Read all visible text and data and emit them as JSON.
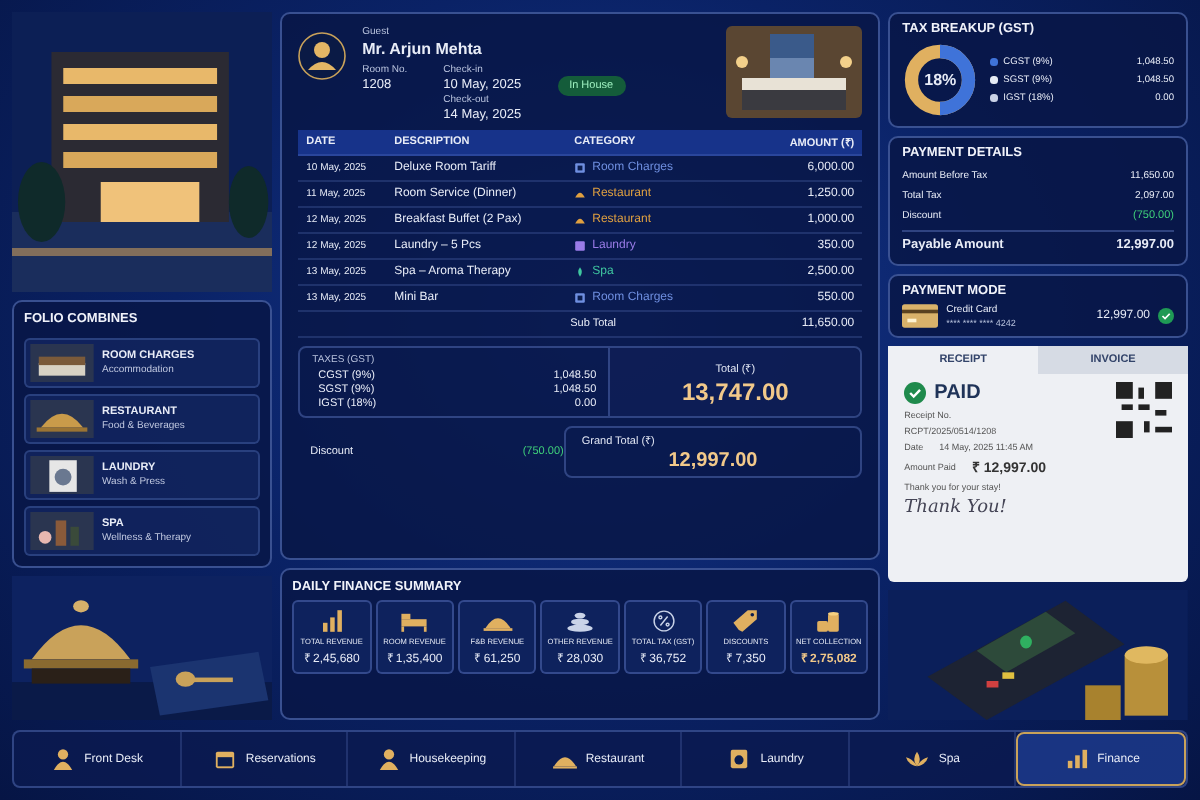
{
  "folio": {
    "title": "FOLIO COMBINES",
    "items": [
      {
        "name": "ROOM CHARGES",
        "sub": "Accommodation",
        "kind": "room"
      },
      {
        "name": "RESTAURANT",
        "sub": "Food & Beverages",
        "kind": "cloche"
      },
      {
        "name": "LAUNDRY",
        "sub": "Wash & Press",
        "kind": "washer"
      },
      {
        "name": "SPA",
        "sub": "Wellness & Therapy",
        "kind": "spa"
      }
    ]
  },
  "guest": {
    "label": "Guest",
    "name": "Mr. Arjun Mehta",
    "room_label": "Room No.",
    "room": "1208",
    "checkin_label": "Check-in",
    "checkin": "10 May, 2025",
    "checkout_label": "Check-out",
    "checkout": "14 May, 2025",
    "status": "In House"
  },
  "table": {
    "columns": [
      "DATE",
      "DESCRIPTION",
      "CATEGORY",
      "AMOUNT (₹)"
    ],
    "rows": [
      {
        "date": "10 May, 2025",
        "description": "Deluxe Room Tariff",
        "category": "Room Charges",
        "kind": "room",
        "color": "#6f8fe0",
        "amount": "6,000.00"
      },
      {
        "date": "11 May, 2025",
        "description": "Room Service (Dinner)",
        "category": "Restaurant",
        "kind": "food",
        "color": "#e0a040",
        "amount": "1,250.00"
      },
      {
        "date": "12 May, 2025",
        "description": "Breakfast Buffet (2 Pax)",
        "category": "Restaurant",
        "kind": "food",
        "color": "#e0a040",
        "amount": "1,000.00"
      },
      {
        "date": "12 May, 2025",
        "description": "Laundry – 5 Pcs",
        "category": "Laundry",
        "kind": "laundry",
        "color": "#9a7ce8",
        "amount": "350.00"
      },
      {
        "date": "13 May, 2025",
        "description": "Spa – Aroma Therapy",
        "category": "Spa",
        "kind": "spa",
        "color": "#3fc7a0",
        "amount": "2,500.00"
      },
      {
        "date": "13 May, 2025",
        "description": "Mini Bar",
        "category": "Room Charges",
        "kind": "room",
        "color": "#6f8fe0",
        "amount": "550.00"
      }
    ],
    "subtotal_label": "Sub Total",
    "subtotal": "11,650.00"
  },
  "taxes": {
    "title": "TAXES (GST)",
    "rows": [
      {
        "label": "CGST (9%)",
        "value": "1,048.50"
      },
      {
        "label": "SGST (9%)",
        "value": "1,048.50"
      },
      {
        "label": "IGST (18%)",
        "value": "0.00"
      }
    ],
    "total_label": "Total (₹)",
    "total": "13,747.00",
    "discount_label": "Discount",
    "discount": "(750.00)",
    "grand_label": "Grand Total (₹)",
    "grand": "12,997.00"
  },
  "tax_breakup": {
    "title": "TAX BREAKUP (GST)",
    "center": "18%",
    "items": [
      {
        "label": "CGST (9%)",
        "value": "1,048.50",
        "color": "#3f73d9"
      },
      {
        "label": "SGST (9%)",
        "value": "1,048.50",
        "color": "#e6ebf5"
      },
      {
        "label": "IGST (18%)",
        "value": "0.00",
        "color": "#c9d2e6"
      }
    ]
  },
  "payment_details": {
    "title": "PAYMENT DETAILS",
    "rows": [
      {
        "label": "Amount Before Tax",
        "value": "11,650.00",
        "kind": "plain"
      },
      {
        "label": "Total Tax",
        "value": "2,097.00",
        "kind": "plain"
      },
      {
        "label": "Discount",
        "value": "(750.00)",
        "kind": "discount"
      }
    ],
    "payable_label": "Payable Amount",
    "payable": "12,997.00"
  },
  "payment_mode": {
    "title": "PAYMENT MODE",
    "method": "Credit Card",
    "card": "**** **** **** 4242",
    "amount": "12,997.00",
    "verified": true
  },
  "receipt": {
    "tabs": [
      {
        "label": "RECEIPT",
        "selected": true
      },
      {
        "label": "INVOICE",
        "selected": false
      }
    ],
    "status": "PAID",
    "no_label": "Receipt No.",
    "no": "RCPT/2025/0514/1208",
    "date_label": "Date",
    "date": "14 May, 2025 11:45 AM",
    "paid_label": "Amount Paid",
    "paid": "₹ 12,997.00",
    "thanks": "Thank you for your stay!",
    "signature": "Thank You!"
  },
  "summary": {
    "title": "DAILY FINANCE SUMMARY",
    "tiles": [
      {
        "label": "TOTAL REVENUE",
        "value": "₹ 2,45,680",
        "kind": "bars"
      },
      {
        "label": "ROOM REVENUE",
        "value": "₹ 1,35,400",
        "kind": "bed"
      },
      {
        "label": "F&B REVENUE",
        "value": "₹ 61,250",
        "kind": "cloche"
      },
      {
        "label": "OTHER REVENUE",
        "value": "₹ 28,030",
        "kind": "stones"
      },
      {
        "label": "TOTAL TAX (GST)",
        "value": "₹ 36,752",
        "kind": "percent"
      },
      {
        "label": "DISCOUNTS",
        "value": "₹ 7,350",
        "kind": "tag"
      },
      {
        "label": "NET COLLECTION",
        "value": "₹ 2,75,082",
        "kind": "coins"
      }
    ]
  },
  "nav": [
    {
      "label": "Front Desk",
      "kind": "person",
      "selected": false
    },
    {
      "label": "Reservations",
      "kind": "calendar",
      "selected": false
    },
    {
      "label": "Housekeeping",
      "kind": "person",
      "selected": false
    },
    {
      "label": "Restaurant",
      "kind": "cloche",
      "selected": false
    },
    {
      "label": "Laundry",
      "kind": "washer",
      "selected": false
    },
    {
      "label": "Spa",
      "kind": "lotus",
      "selected": false
    },
    {
      "label": "Finance",
      "kind": "bars",
      "selected": true
    }
  ]
}
